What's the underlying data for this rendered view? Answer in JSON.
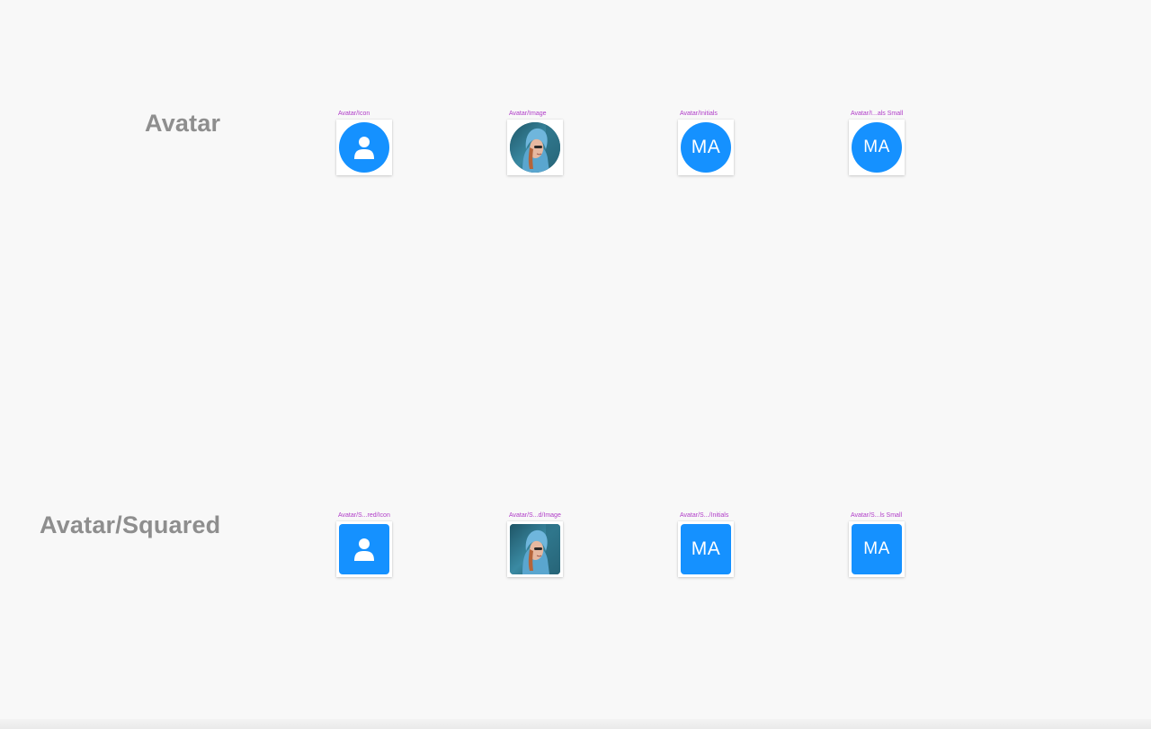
{
  "sections": [
    {
      "title": "Avatar",
      "shape": "round",
      "frames": [
        {
          "label": "Avatar/Icon",
          "kind": "icon",
          "icon": "person-icon"
        },
        {
          "label": "Avatar/Image",
          "kind": "image",
          "image": "woman-in-blue-hoodie-photo"
        },
        {
          "label": "Avatar/Initials",
          "kind": "initials",
          "initials": "MA"
        },
        {
          "label": "Avatar/I...als Small",
          "kind": "initials",
          "initials": "MA"
        }
      ]
    },
    {
      "title": "Avatar/Squared",
      "shape": "squared",
      "frames": [
        {
          "label": "Avatar/S...red/Icon",
          "kind": "icon",
          "icon": "person-icon"
        },
        {
          "label": "Avatar/S...d/Image",
          "kind": "image",
          "image": "woman-in-blue-hoodie-photo"
        },
        {
          "label": "Avatar/S.../Initials",
          "kind": "initials",
          "initials": "MA"
        },
        {
          "label": "Avatar/S...ls Small",
          "kind": "initials",
          "initials": "MA"
        }
      ]
    }
  ],
  "colors": {
    "avatar_fill": "#1591ff",
    "frame_label": "#b03cc8",
    "section_title": "#8e8e8e",
    "canvas": "#f8f8f8"
  }
}
